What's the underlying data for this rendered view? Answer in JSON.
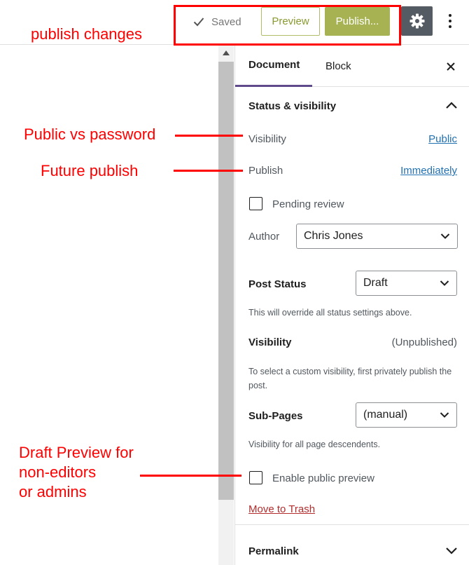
{
  "header": {
    "saved_label": "Saved",
    "preview_label": "Preview",
    "publish_label": "Publish...",
    "settings_icon": "gear-icon",
    "more_icon": "more-vertical-icon",
    "accent_color": "#a7b353",
    "settings_bg": "#545b62"
  },
  "sidebar": {
    "tabs": [
      {
        "label": "Document",
        "active": true
      },
      {
        "label": "Block",
        "active": false
      }
    ],
    "close_icon": "close-icon",
    "panel_title": "Status & visibility",
    "visibility_label": "Visibility",
    "visibility_value": "Public",
    "publish_label": "Publish",
    "publish_value": "Immediately",
    "pending_review_label": "Pending review",
    "author_label": "Author",
    "author_value": "Chris Jones",
    "post_status_label": "Post Status",
    "post_status_value": "Draft",
    "post_status_help": "This will override all status settings above.",
    "visibility2_label": "Visibility",
    "visibility2_value": "(Unpublished)",
    "visibility2_help": "To select a custom visibility, first privately publish the post.",
    "subpages_label": "Sub-Pages",
    "subpages_value": "(manual)",
    "subpages_help": "Visibility for all page descendents.",
    "public_preview_label": "Enable public preview",
    "trash_label": "Move to Trash",
    "permalink_title": "Permalink",
    "link_color": "#2271b1",
    "trash_color": "#b32d2e"
  },
  "annotations": {
    "publish_changes": "publish changes",
    "public_vs_password": "Public vs password",
    "future_publish": "Future publish",
    "draft_preview_line1": "Draft Preview for",
    "draft_preview_line2": "non-editors",
    "draft_preview_line3": "or admins",
    "color": "#ff0000"
  }
}
